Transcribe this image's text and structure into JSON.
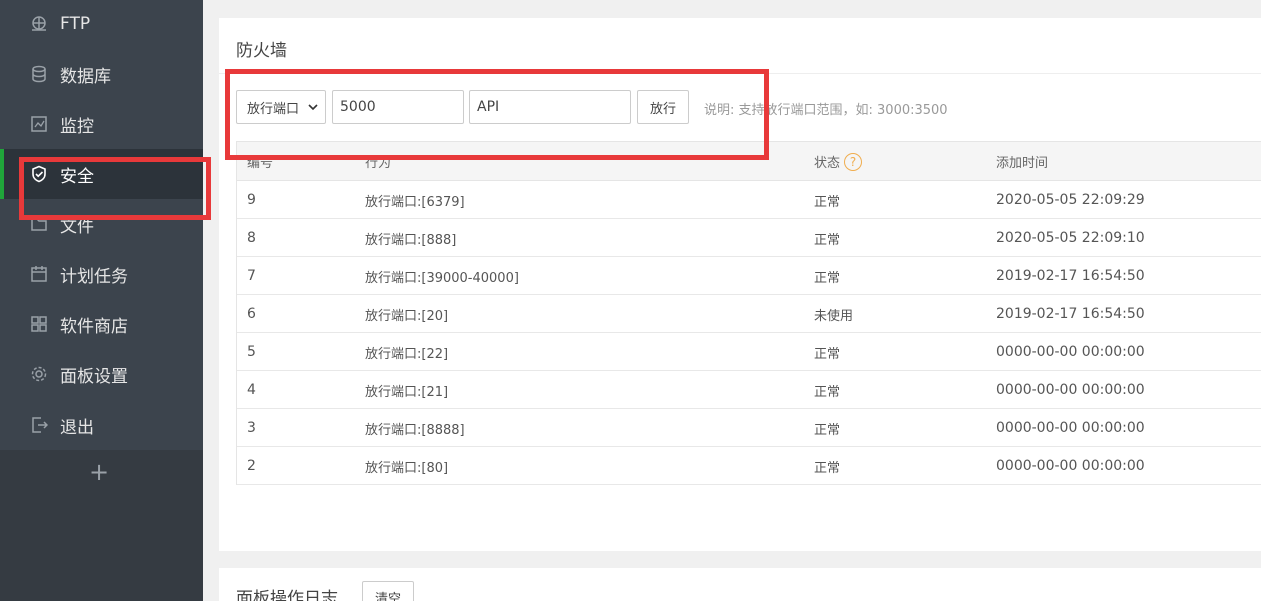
{
  "sidebar": {
    "items": [
      {
        "label": "FTP",
        "icon": "ftp-icon"
      },
      {
        "label": "数据库",
        "icon": "database-icon"
      },
      {
        "label": "监控",
        "icon": "monitor-icon"
      },
      {
        "label": "安全",
        "icon": "shield-icon",
        "active": true
      },
      {
        "label": "文件",
        "icon": "folder-icon"
      },
      {
        "label": "计划任务",
        "icon": "calendar-icon"
      },
      {
        "label": "软件商店",
        "icon": "grid-icon"
      },
      {
        "label": "面板设置",
        "icon": "gear-icon"
      },
      {
        "label": "退出",
        "icon": "logout-icon"
      }
    ],
    "add_label": "+"
  },
  "firewall": {
    "title": "防火墙",
    "select_value": "放行端口",
    "port_value": "5000",
    "remark_value": "API",
    "allow_label": "放行",
    "hint": "说明: 支持放行端口范围，如: 3000:3500",
    "columns": [
      "编号",
      "行为",
      "状态",
      "添加时间"
    ],
    "rows": [
      {
        "id": "9",
        "action": "放行端口:[6379]",
        "status": "正常",
        "time": "2020-05-05 22:09:29"
      },
      {
        "id": "8",
        "action": "放行端口:[888]",
        "status": "正常",
        "time": "2020-05-05 22:09:10"
      },
      {
        "id": "7",
        "action": "放行端口:[39000-40000]",
        "status": "正常",
        "time": "2019-02-17 16:54:50"
      },
      {
        "id": "6",
        "action": "放行端口:[20]",
        "status": "未使用",
        "time": "2019-02-17 16:54:50"
      },
      {
        "id": "5",
        "action": "放行端口:[22]",
        "status": "正常",
        "time": "0000-00-00 00:00:00"
      },
      {
        "id": "4",
        "action": "放行端口:[21]",
        "status": "正常",
        "time": "0000-00-00 00:00:00"
      },
      {
        "id": "3",
        "action": "放行端口:[8888]",
        "status": "正常",
        "time": "0000-00-00 00:00:00"
      },
      {
        "id": "2",
        "action": "放行端口:[80]",
        "status": "正常",
        "time": "0000-00-00 00:00:00"
      }
    ]
  },
  "log_panel": {
    "title": "面板操作日志",
    "clear_label": "清空"
  },
  "colors": {
    "sidebar_bg": "#3c444d",
    "active_bg": "#2c333a",
    "accent": "#20a53a",
    "highlight": "#e8393a"
  }
}
